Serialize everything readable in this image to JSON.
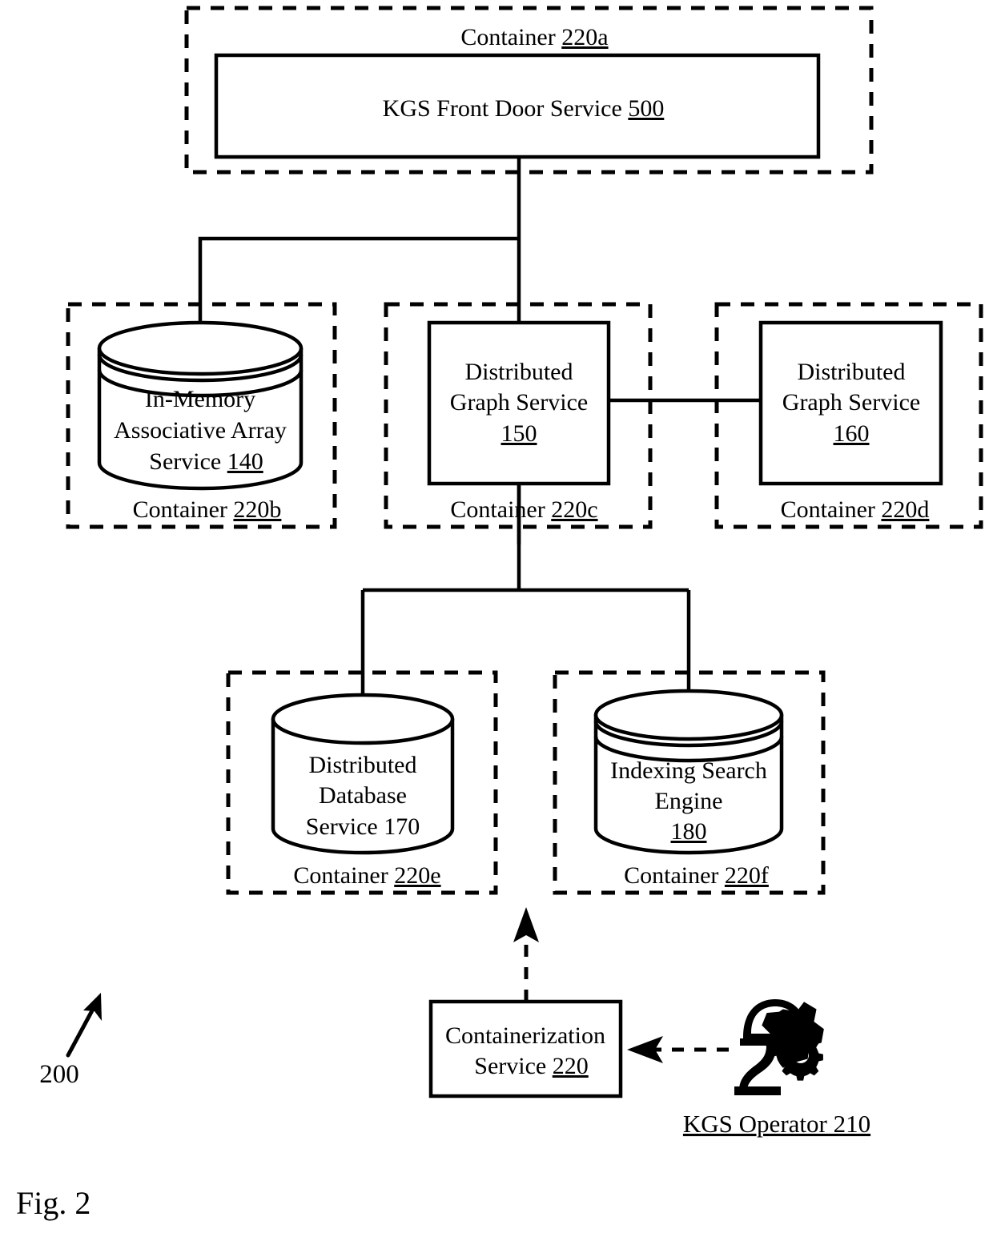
{
  "figure": {
    "label": "Fig. 2",
    "reference_numeral": "200"
  },
  "containers": {
    "a": {
      "label_prefix": "Container ",
      "ref": "220a"
    },
    "b": {
      "label_prefix": "Container ",
      "ref": "220b"
    },
    "c": {
      "label_prefix": "Container ",
      "ref": "220c"
    },
    "d": {
      "label_prefix": "Container ",
      "ref": "220d"
    },
    "e": {
      "label_prefix": "Container ",
      "ref": "220e"
    },
    "f": {
      "label_prefix": "Container ",
      "ref": "220f"
    }
  },
  "nodes": {
    "front_door": {
      "name": "KGS Front Door Service",
      "line1": "KGS Front Door Service ",
      "ref": "500",
      "shape": "rectangle"
    },
    "in_memory": {
      "name": "In-Memory Associative Array Service",
      "line1": "In-Memory",
      "line2": "Associative Array",
      "line3": "Service ",
      "ref": "140",
      "shape": "cylinder-multiring"
    },
    "graph_150": {
      "name": "Distributed Graph Service",
      "line1": "Distributed",
      "line2": "Graph Service",
      "ref": "150",
      "shape": "rectangle"
    },
    "graph_160": {
      "name": "Distributed Graph Service",
      "line1": "Distributed",
      "line2": "Graph Service",
      "ref": "160",
      "shape": "rectangle"
    },
    "database_170": {
      "name": "Distributed Database Service",
      "line1": "Distributed",
      "line2": "Database",
      "line3": "Service 170",
      "ref": "170",
      "shape": "cylinder-singlering"
    },
    "search_180": {
      "name": "Indexing Search Engine",
      "line1": "Indexing Search",
      "line2": "Engine",
      "ref": "180",
      "shape": "cylinder-multiring"
    },
    "containerization": {
      "name": "Containerization Service",
      "line1": "Containerization",
      "line2": "Service ",
      "ref": "220",
      "shape": "rectangle"
    },
    "operator": {
      "name": "KGS Operator",
      "label": "KGS Operator 210",
      "ref": "210",
      "icon": "operator-gear-icon"
    }
  },
  "colors": {
    "stroke": "#000000",
    "fill": "#ffffff"
  }
}
